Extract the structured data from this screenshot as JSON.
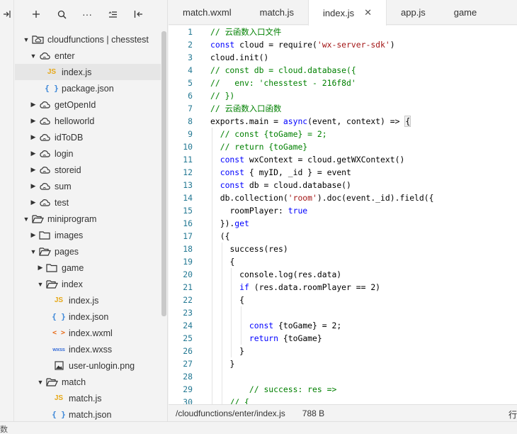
{
  "left_strip": {
    "toggle_icon": "panel-toggle-icon"
  },
  "explorer": {
    "toolbar": [
      {
        "name": "new-file-button",
        "glyph": "+"
      },
      {
        "name": "search-button",
        "glyph": "⚲"
      },
      {
        "name": "more-button",
        "glyph": "···"
      },
      {
        "name": "sort-button",
        "glyph": "≡"
      },
      {
        "name": "collapse-panel-button",
        "glyph": "⫞"
      }
    ],
    "tree": [
      {
        "depth": 0,
        "label": "cloudfunctions | chesstest",
        "icon": "cloud-folder",
        "chevron": "open"
      },
      {
        "depth": 1,
        "label": "enter",
        "icon": "cloud",
        "chevron": "open"
      },
      {
        "depth": 2,
        "label": "index.js",
        "icon": "js",
        "selected": true
      },
      {
        "depth": 2,
        "label": "package.json",
        "icon": "json"
      },
      {
        "depth": 1,
        "label": "getOpenId",
        "icon": "cloud",
        "chevron": "closed"
      },
      {
        "depth": 1,
        "label": "helloworld",
        "icon": "cloud",
        "chevron": "closed"
      },
      {
        "depth": 1,
        "label": "idToDB",
        "icon": "cloud",
        "chevron": "closed"
      },
      {
        "depth": 1,
        "label": "login",
        "icon": "cloud",
        "chevron": "closed"
      },
      {
        "depth": 1,
        "label": "storeid",
        "icon": "cloud",
        "chevron": "closed"
      },
      {
        "depth": 1,
        "label": "sum",
        "icon": "cloud",
        "chevron": "closed"
      },
      {
        "depth": 1,
        "label": "test",
        "icon": "cloud",
        "chevron": "closed"
      },
      {
        "depth": 0,
        "label": "miniprogram",
        "icon": "folder-open",
        "chevron": "open"
      },
      {
        "depth": 1,
        "label": "images",
        "icon": "folder",
        "chevron": "closed"
      },
      {
        "depth": 1,
        "label": "pages",
        "icon": "folder-open",
        "chevron": "open"
      },
      {
        "depth": 2,
        "label": "game",
        "icon": "folder",
        "chevron": "closed"
      },
      {
        "depth": 2,
        "label": "index",
        "icon": "folder-open",
        "chevron": "open"
      },
      {
        "depth": 3,
        "label": "index.js",
        "icon": "js"
      },
      {
        "depth": 3,
        "label": "index.json",
        "icon": "json"
      },
      {
        "depth": 3,
        "label": "index.wxml",
        "icon": "wxml"
      },
      {
        "depth": 3,
        "label": "index.wxss",
        "icon": "wxss"
      },
      {
        "depth": 3,
        "label": "user-unlogin.png",
        "icon": "image"
      },
      {
        "depth": 2,
        "label": "match",
        "icon": "folder-open",
        "chevron": "open"
      },
      {
        "depth": 3,
        "label": "match.js",
        "icon": "js"
      },
      {
        "depth": 3,
        "label": "match.json",
        "icon": "json"
      }
    ],
    "badges": {
      "js": "JS",
      "json": "{ }",
      "wxml": "< >",
      "wxss": "wxss"
    }
  },
  "tabs": [
    {
      "label": "match.wxml",
      "active": false
    },
    {
      "label": "match.js",
      "active": false
    },
    {
      "label": "index.js",
      "active": true,
      "close": "✕"
    },
    {
      "label": "app.js",
      "active": false
    },
    {
      "label": "game",
      "active": false
    }
  ],
  "editor": {
    "lines": [
      {
        "n": "1",
        "indent": 0,
        "tokens": [
          [
            "c",
            "// 云函数入口文件"
          ]
        ]
      },
      {
        "n": "2",
        "indent": 0,
        "tokens": [
          [
            "k",
            "const"
          ],
          [
            "f",
            " cloud = require("
          ],
          [
            "s",
            "'wx-server-sdk'"
          ],
          [
            "f",
            ")"
          ]
        ]
      },
      {
        "n": "3",
        "indent": 0,
        "tokens": [
          [
            "f",
            "cloud.init()"
          ]
        ]
      },
      {
        "n": "4",
        "indent": 0,
        "tokens": [
          [
            "c",
            "// const db = cloud.database({"
          ]
        ]
      },
      {
        "n": "5",
        "indent": 0,
        "tokens": [
          [
            "c",
            "//   env: 'chesstest - 216f8d'"
          ]
        ]
      },
      {
        "n": "6",
        "indent": 0,
        "tokens": [
          [
            "c",
            "// })"
          ]
        ]
      },
      {
        "n": "7",
        "indent": 0,
        "tokens": [
          [
            "c",
            "// 云函数入口函数"
          ]
        ]
      },
      {
        "n": "8",
        "indent": 0,
        "tokens": [
          [
            "f",
            "exports.main = "
          ],
          [
            "k",
            "async"
          ],
          [
            "f",
            "(event, context) => "
          ],
          [
            "b",
            "{"
          ]
        ]
      },
      {
        "n": "9",
        "indent": 1,
        "tokens": [
          [
            "c",
            "// const {toGame} = 2;"
          ]
        ]
      },
      {
        "n": "10",
        "indent": 1,
        "tokens": [
          [
            "c",
            "// return {toGame}"
          ]
        ]
      },
      {
        "n": "11",
        "indent": 1,
        "tokens": [
          [
            "k",
            "const"
          ],
          [
            "f",
            " wxContext = cloud.getWXContext()"
          ]
        ]
      },
      {
        "n": "12",
        "indent": 1,
        "tokens": [
          [
            "k",
            "const"
          ],
          [
            "f",
            " { myID, _id } = event"
          ]
        ]
      },
      {
        "n": "13",
        "indent": 1,
        "tokens": [
          [
            "k",
            "const"
          ],
          [
            "f",
            " db = cloud.database()"
          ]
        ]
      },
      {
        "n": "14",
        "indent": 1,
        "tokens": [
          [
            "f",
            "db.collection("
          ],
          [
            "s",
            "'room'"
          ],
          [
            "f",
            ").doc(event._id).field({"
          ]
        ]
      },
      {
        "n": "15",
        "indent": 2,
        "tokens": [
          [
            "f",
            "roomPlayer: "
          ],
          [
            "k",
            "true"
          ]
        ]
      },
      {
        "n": "16",
        "indent": 1,
        "tokens": [
          [
            "f",
            "})."
          ],
          [
            "k",
            "get"
          ]
        ]
      },
      {
        "n": "17",
        "indent": 1,
        "tokens": [
          [
            "f",
            "({"
          ]
        ]
      },
      {
        "n": "18",
        "indent": 2,
        "tokens": [
          [
            "f",
            "success(res)"
          ]
        ]
      },
      {
        "n": "19",
        "indent": 2,
        "tokens": [
          [
            "f",
            "{"
          ]
        ]
      },
      {
        "n": "20",
        "indent": 3,
        "tokens": [
          [
            "f",
            "console.log(res.data)"
          ]
        ]
      },
      {
        "n": "21",
        "indent": 3,
        "tokens": [
          [
            "k",
            "if"
          ],
          [
            "f",
            " (res.data.roomPlayer == 2)"
          ]
        ]
      },
      {
        "n": "22",
        "indent": 3,
        "tokens": [
          [
            "f",
            "{"
          ]
        ]
      },
      {
        "n": "23",
        "indent": 3,
        "tokens": []
      },
      {
        "n": "24",
        "indent": 4,
        "tokens": [
          [
            "k",
            "const"
          ],
          [
            "f",
            " {toGame} = 2;"
          ]
        ]
      },
      {
        "n": "25",
        "indent": 4,
        "tokens": [
          [
            "k",
            "return"
          ],
          [
            "f",
            " {toGame}"
          ]
        ]
      },
      {
        "n": "26",
        "indent": 3,
        "tokens": [
          [
            "f",
            "}"
          ]
        ]
      },
      {
        "n": "27",
        "indent": 2,
        "tokens": [
          [
            "f",
            "}"
          ]
        ]
      },
      {
        "n": "28",
        "indent": 2,
        "tokens": []
      },
      {
        "n": "29",
        "indent": 4,
        "tokens": [
          [
            "c",
            "// success: res =>"
          ]
        ]
      },
      {
        "n": "30",
        "indent": 2,
        "tokens": [
          [
            "c",
            "// {"
          ]
        ]
      }
    ]
  },
  "status": {
    "path": "/cloudfunctions/enter/index.js",
    "size": "788 B",
    "position": "行"
  },
  "bottom": {
    "left_text": "数"
  },
  "colors": {
    "comment": "#008000",
    "keyword": "#0000ff",
    "string": "#a31515",
    "line_number": "#237893"
  }
}
